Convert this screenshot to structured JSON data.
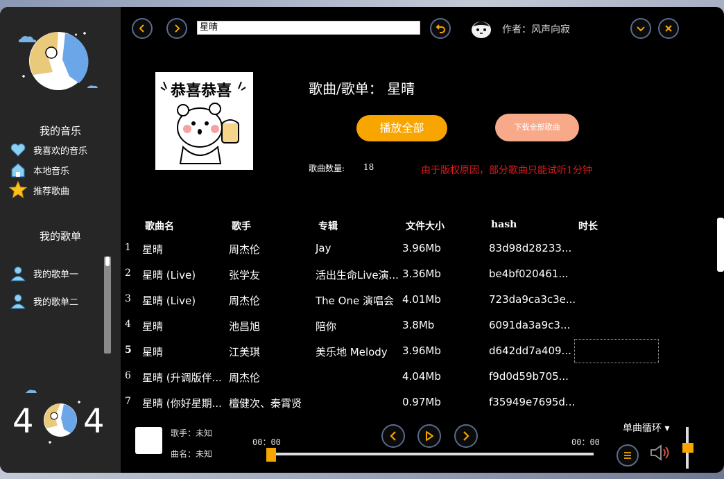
{
  "sidebar": {
    "my_music_title": "我的音乐",
    "music_items": [
      {
        "label": "我喜欢的音乐",
        "icon": "heart-icon"
      },
      {
        "label": "本地音乐",
        "icon": "home-icon"
      },
      {
        "label": "推荐歌曲",
        "icon": "star-icon"
      }
    ],
    "playlist_title": "我的歌单",
    "playlist_items": [
      {
        "label": "我的歌单一",
        "icon": "user-icon"
      },
      {
        "label": "我的歌单二",
        "icon": "user-icon"
      }
    ]
  },
  "topbar": {
    "search_value": "星晴",
    "author_text": "作者：风声向寂"
  },
  "header": {
    "cover_text": "恭喜恭喜",
    "title": "歌曲/歌单： 星晴",
    "play_all": "播放全部",
    "download_all": "下载全部歌曲",
    "count_label": "歌曲数量:",
    "count_value": "18",
    "notice": "由于版权原因，部分歌曲只能试听1分钟"
  },
  "table": {
    "columns": [
      "歌曲名",
      "歌手",
      "专辑",
      "文件大小",
      "hash",
      "时长"
    ],
    "rows": [
      {
        "idx": "1",
        "name": "星晴",
        "singer": "周杰伦",
        "album": "Jay",
        "size": "3.96Mb",
        "hash": "83d98d28233..."
      },
      {
        "idx": "2",
        "name": "星晴 (Live)",
        "singer": "张学友",
        "album": "活出生命Live演...",
        "size": "3.36Mb",
        "hash": "be4bf020461..."
      },
      {
        "idx": "3",
        "name": "星晴 (Live)",
        "singer": "周杰伦",
        "album": "The One 演唱会",
        "size": "4.01Mb",
        "hash": "723da9ca3c3e..."
      },
      {
        "idx": "4",
        "name": "星晴",
        "singer": "池昌旭",
        "album": "陪你",
        "size": "3.8Mb",
        "hash": "6091da3a9c3..."
      },
      {
        "idx": "5",
        "name": "星晴",
        "singer": "江美琪",
        "album": "美乐地 Melody",
        "size": "3.96Mb",
        "hash": "d642dd7a409..."
      },
      {
        "idx": "6",
        "name": "星晴 (升调版伴...",
        "singer": "周杰伦",
        "album": "",
        "size": "4.04Mb",
        "hash": "f9d0d59b705..."
      },
      {
        "idx": "7",
        "name": "星晴 (你好星期...",
        "singer": "檀健次、秦霄贤",
        "album": "",
        "size": "0.97Mb",
        "hash": "f35949e7695d..."
      }
    ]
  },
  "player": {
    "singer_label": "歌手：未知",
    "song_label": "曲名：未知",
    "time_current": "00：00",
    "time_total": "00：00",
    "progress": 0,
    "loop_mode": "单曲循环 ▾",
    "volume": 0.6
  },
  "colors": {
    "accent": "#f8a500",
    "download": "#f7a98a",
    "notice": "#e01b1b",
    "button_border": "#5a6b8a"
  }
}
